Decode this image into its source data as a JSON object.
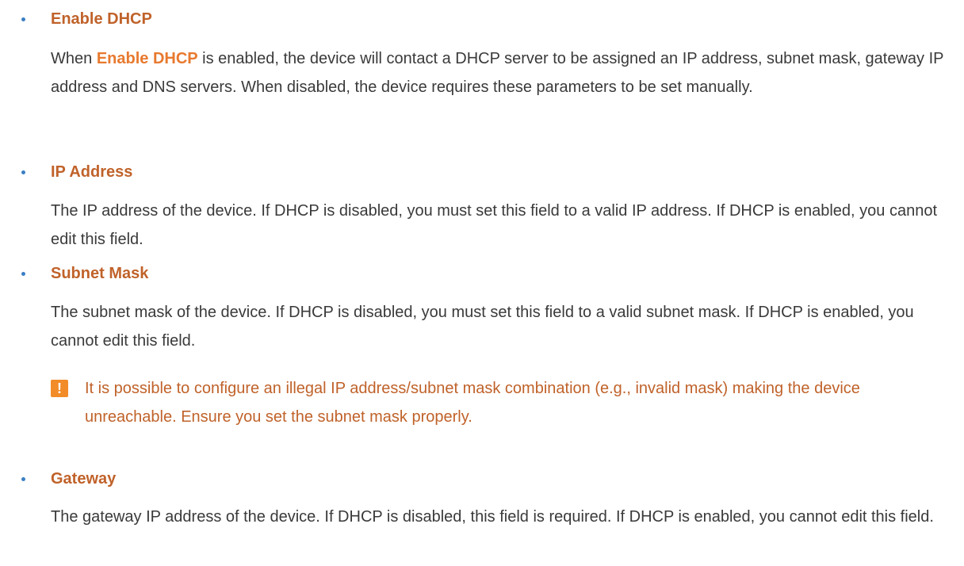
{
  "sections": [
    {
      "term": "Enable DHCP",
      "description_prefix": "When ",
      "description_term": "Enable DHCP",
      "description_suffix": " is enabled, the device will contact a DHCP server to be assigned an IP address, subnet mask, gateway IP address and DNS servers. When disabled, the device requires these parameters to be set manually."
    },
    {
      "term": "IP Address",
      "description": "The IP address of the device. If DHCP is disabled, you must set this field to a valid IP address. If DHCP is enabled, you cannot edit this field."
    },
    {
      "term": "Subnet Mask",
      "description": "The subnet mask of the device. If DHCP is disabled, you must set this field to a valid subnet mask. If DHCP is enabled, you cannot edit this field."
    },
    {
      "term": "Gateway",
      "description": "The gateway IP address of the device. If DHCP is disabled, this field is required. If DHCP is enabled, you cannot edit this field."
    }
  ],
  "note": {
    "icon": "warning-icon",
    "icon_glyph": "!",
    "text": "It is possible to configure an illegal IP address/subnet mask combination (e.g., invalid mask) making the device unreachable. Ensure you set the subnet mask properly."
  },
  "colors": {
    "term": "#c0622a",
    "inline_term": "#e8792e",
    "note_icon": "#f28c28",
    "bullet": "#3b7fc4",
    "body_text": "#3a3a3a"
  }
}
